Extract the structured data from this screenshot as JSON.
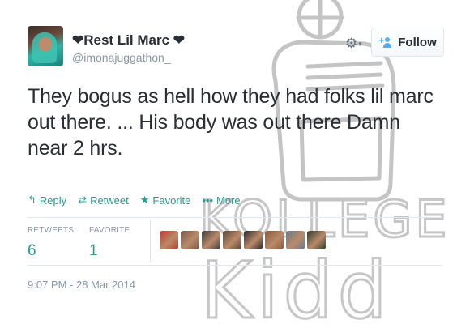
{
  "tweet": {
    "display_name": "❤Rest Lil Marc ❤",
    "handle": "@imonajuggathon_",
    "text": "They bogus as hell how they had folks lil marc out there. ... His body was out there Damn near 2 hrs.",
    "timestamp": "9:07 PM - 28 Mar 2014"
  },
  "header": {
    "gear_icon": "gear-icon",
    "follow_label": "Follow"
  },
  "actions": [
    {
      "label": "Reply",
      "icon": "reply-icon",
      "glyph": "↰"
    },
    {
      "label": "Retweet",
      "icon": "retweet-icon",
      "glyph": "⇄"
    },
    {
      "label": "Favorite",
      "icon": "star-icon",
      "glyph": "★"
    },
    {
      "label": "More",
      "icon": "more-icon",
      "glyph": "•••"
    }
  ],
  "stats": {
    "retweets_label": "RETWEETS",
    "retweets_value": "6",
    "favorites_label": "FAVORITE",
    "favorites_value": "1"
  },
  "favoriter_avatars": [
    {
      "color": "#c0392b"
    },
    {
      "color": "#7a5a4a"
    },
    {
      "color": "#3d3d3d"
    },
    {
      "color": "#5a4636"
    },
    {
      "color": "#2a2a2a"
    },
    {
      "color": "#8a5a3a"
    },
    {
      "color": "#6a7a8a"
    },
    {
      "color": "#2f3a2a"
    }
  ],
  "watermark": {
    "text_top": "KOLLEGE",
    "text_bottom": "Kidd"
  },
  "colors": {
    "accent": "#2b9a8f",
    "follow_blue": "#55acee",
    "muted": "#8899a6"
  }
}
